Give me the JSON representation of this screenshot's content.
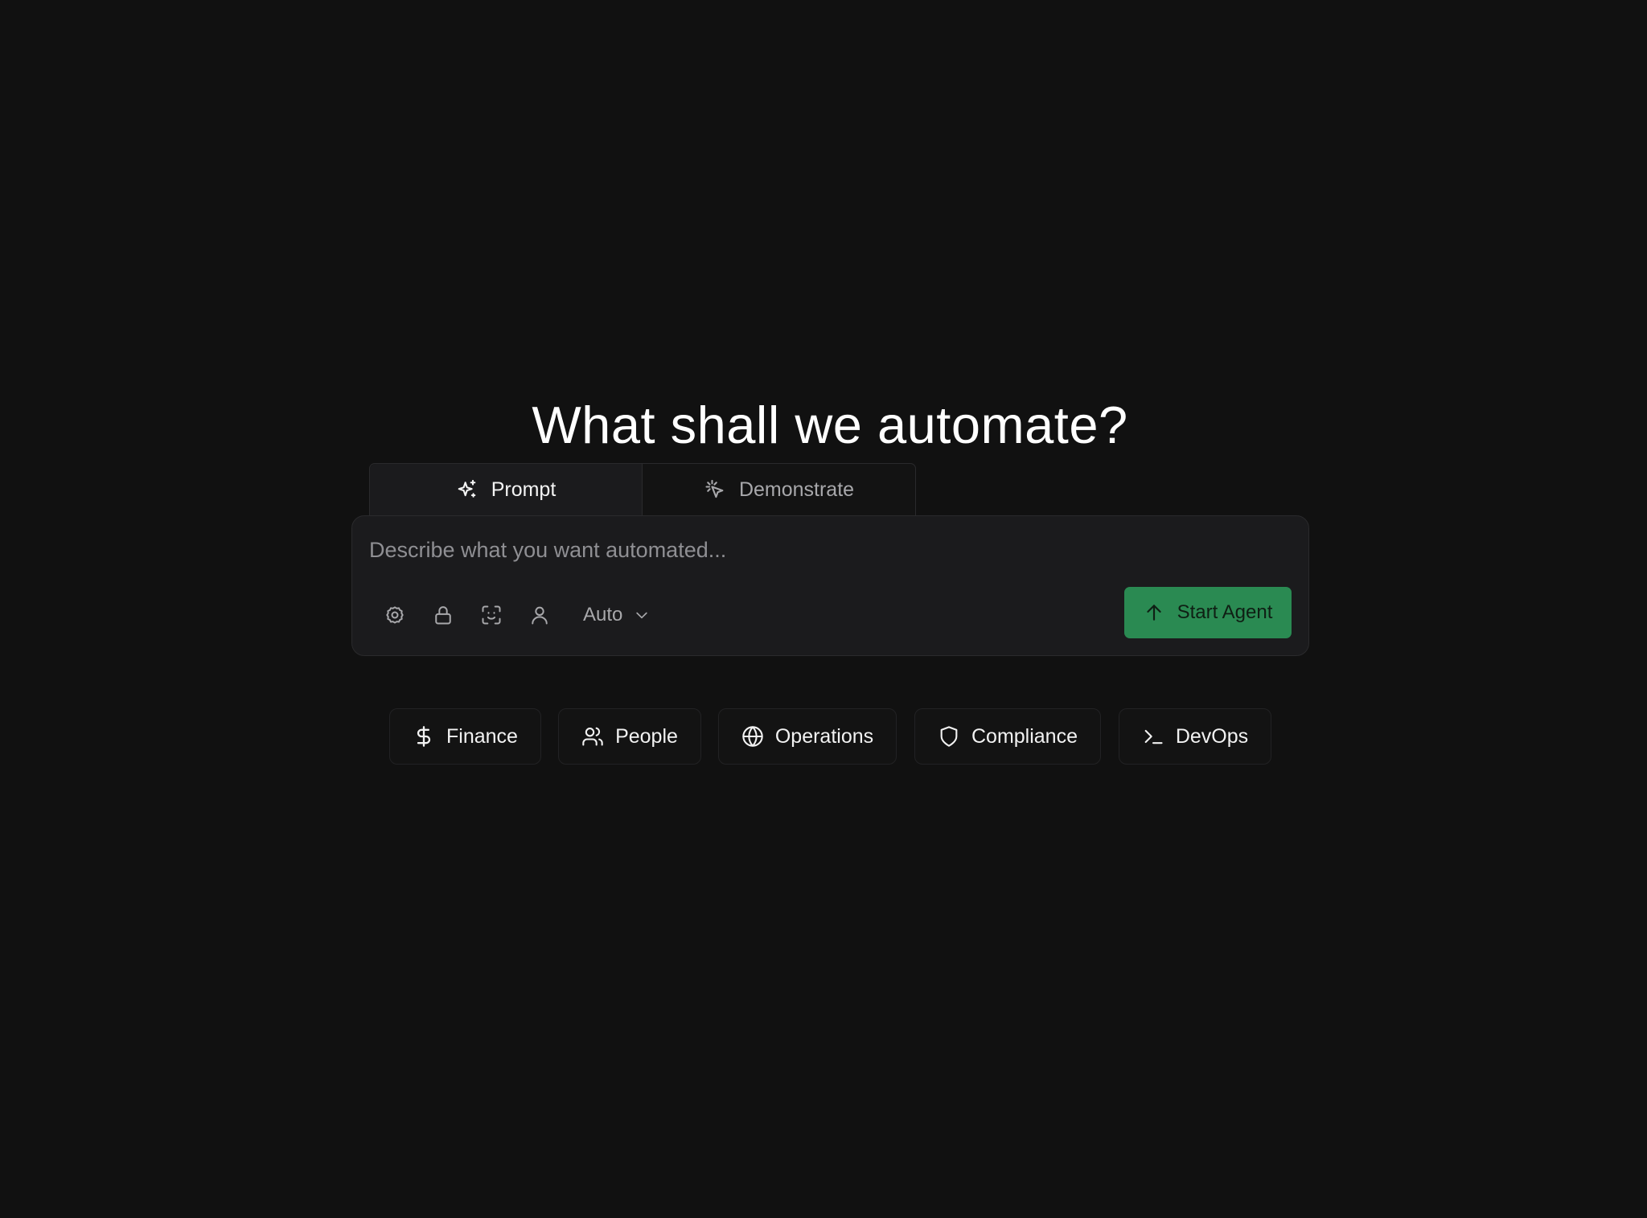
{
  "heading": "What shall we automate?",
  "tabs": [
    {
      "label": "Prompt",
      "icon": "sparkles-icon",
      "active": true
    },
    {
      "label": "Demonstrate",
      "icon": "cursor-click-icon",
      "active": false
    }
  ],
  "composer": {
    "placeholder": "Describe what you want automated...",
    "value": "",
    "tools": [
      "gear-icon",
      "lock-icon",
      "face-scan-icon",
      "user-icon"
    ],
    "model": {
      "selected": "Auto",
      "icon": "chevron-down-icon"
    },
    "submit": {
      "label": "Start Agent",
      "icon": "arrow-up-icon"
    }
  },
  "categories": [
    {
      "label": "Finance",
      "icon": "dollar-icon"
    },
    {
      "label": "People",
      "icon": "users-icon"
    },
    {
      "label": "Operations",
      "icon": "globe-icon"
    },
    {
      "label": "Compliance",
      "icon": "shield-icon"
    },
    {
      "label": "DevOps",
      "icon": "terminal-icon"
    }
  ],
  "colors": {
    "background": "#111111",
    "card": "#1b1b1d",
    "accent": "#2a8a52",
    "text": "#ffffff",
    "muted": "#a8a8ab"
  }
}
